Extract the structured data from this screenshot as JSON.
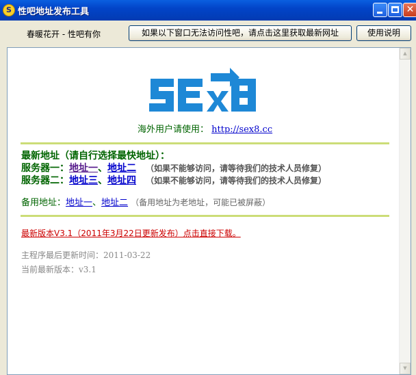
{
  "window": {
    "title": "性吧地址发布工具",
    "app_icon_letter": "S"
  },
  "toolbar": {
    "slogan": "春暖花开 - 性吧有你",
    "refresh_button": "如果以下窗口无法访问性吧，请点击这里获取最新网址",
    "help_button": "使用说明"
  },
  "content": {
    "logo_text": "SEX8",
    "overseas_label": "海外用户请使用：",
    "overseas_url": "http://sex8.cc",
    "latest_title": "最新地址（请自行选择最快地址）：",
    "server1_label": "服务器一：",
    "server1_link1": "地址一",
    "server1_sep": "、",
    "server1_link2": "地址二",
    "server1_note": "（如果不能够访问，请等待我们的技术人员修复）",
    "server2_label": "服务器二：",
    "server2_link1": "地址三",
    "server2_sep": "、",
    "server2_link2": "地址四",
    "server2_note": "（如果不能够访问，请等待我们的技术人员修复）",
    "backup_label": "备用地址：",
    "backup_link1": "地址一",
    "backup_sep": "、",
    "backup_link2": "地址二",
    "backup_note": "（备用地址为老地址，可能已被屏蔽）",
    "version_link": "最新版本V3.1（2011年3月22日更新发布）点击直接下载。",
    "update_time_label": "主程序最后更新时间：",
    "update_time_value": "2011-03-22",
    "current_version_label": "当前最新版本：",
    "current_version_value": "v3.1"
  },
  "colors": {
    "title_bar": "#0244c8",
    "logo_blue": "#1e88d6",
    "section_green": "#006400",
    "divider": "#ccdd77",
    "link_blue": "#0000cc",
    "version_red": "#cc0000"
  }
}
